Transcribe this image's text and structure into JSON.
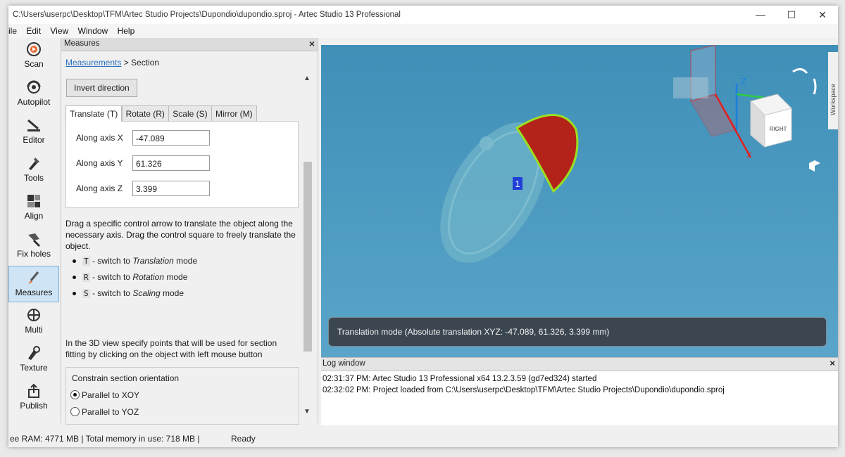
{
  "window": {
    "title": "C:\\Users\\userpc\\Desktop\\TFM\\Artec Studio Projects\\Dupondio\\dupondio.sproj - Artec Studio 13 Professional",
    "minimize": "—",
    "maximize": "☐",
    "close": "✕"
  },
  "menu": [
    "ile",
    "Edit",
    "View",
    "Window",
    "Help"
  ],
  "toolbar": [
    {
      "label": "Scan",
      "icon": "scan-icon"
    },
    {
      "label": "Autopilot",
      "icon": "autopilot-icon"
    },
    {
      "label": "Editor",
      "icon": "editor-icon"
    },
    {
      "label": "Tools",
      "icon": "tools-icon"
    },
    {
      "label": "Align",
      "icon": "align-icon"
    },
    {
      "label": "Fix holes",
      "icon": "fix-holes-icon"
    },
    {
      "label": "Measures",
      "icon": "measures-icon"
    },
    {
      "label": "Multi",
      "icon": "multi-icon"
    },
    {
      "label": "Texture",
      "icon": "texture-icon"
    },
    {
      "label": "Publish",
      "icon": "publish-icon"
    }
  ],
  "panel": {
    "title": "Measures",
    "close": "×",
    "breadcrumb_link": "Measurements",
    "breadcrumb_current": " > Section",
    "invert_button": "Invert direction",
    "tabs": [
      "Translate (T)",
      "Rotate (R)",
      "Scale (S)",
      "Mirror (M)"
    ],
    "fields": [
      {
        "label": "Along axis X",
        "value": "-47.089"
      },
      {
        "label": "Along axis Y",
        "value": "61.326"
      },
      {
        "label": "Along axis Z",
        "value": "3.399"
      }
    ],
    "help_text": "Drag a specific control arrow to translate the object along the necessary axis. Drag the control square to freely translate the object.",
    "shortcuts": [
      {
        "key": "T",
        "pre": " - switch to ",
        "mode": "Translation",
        "post": " mode"
      },
      {
        "key": "R",
        "pre": " - switch to ",
        "mode": "Rotation",
        "post": " mode"
      },
      {
        "key": "S",
        "pre": " - switch to ",
        "mode": "Scaling",
        "post": " mode"
      }
    ],
    "section_help": "In the 3D view specify points that will be used for section fitting by clicking on the object with left mouse button",
    "constrain_title": "Constrain section orientation",
    "radios": [
      {
        "label": "Parallel to XOY",
        "checked": true
      },
      {
        "label": "Parallel to YOZ",
        "checked": false
      }
    ]
  },
  "view3d": {
    "marker": "1",
    "cube_label": "RIGHT",
    "axis_z": "Z",
    "axis_x": "X",
    "side_tab": "Workspace",
    "overlay": "Translation mode (Absolute translation XYZ: -47.089, 61.326, 3.399 mm)",
    "colors": {
      "background": "#4a9ac0",
      "section": "#b3231a",
      "outline": "#9be020"
    }
  },
  "log": {
    "title": "Log window",
    "close": "×",
    "lines": [
      "02:31:37 PM: Artec Studio 13 Professional x64 13.2.3.59 (gd7ed324) started",
      "02:32:02 PM: Project loaded from C:\\Users\\userpc\\Desktop\\TFM\\Artec Studio Projects\\Dupondio\\dupondio.sproj"
    ]
  },
  "status": {
    "free_ram": "ee RAM: 4771 MB  |  Total memory in use: 718 MB  |",
    "ready": "Ready"
  }
}
